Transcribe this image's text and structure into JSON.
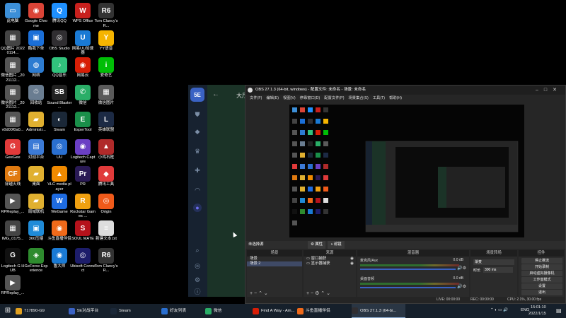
{
  "desktop": {
    "icons": [
      {
        "label": "此电脑",
        "color": "#3c8fd8",
        "glyph": "▭"
      },
      {
        "label": "Google Chrome",
        "color": "#db4437",
        "glyph": "◉"
      },
      {
        "label": "腾讯QQ",
        "color": "#1e90ff",
        "glyph": "Q"
      },
      {
        "label": "WPS Office",
        "color": "#c8201d",
        "glyph": "W"
      },
      {
        "label": "Tom Clancy's R...",
        "color": "#333333",
        "glyph": "R6"
      },
      {
        "label": "QQ图片 20220114...",
        "color": "#444444",
        "glyph": "▦"
      },
      {
        "label": "酷我下单",
        "color": "#1b6fd8",
        "glyph": "▣"
      },
      {
        "label": "OBS Studio",
        "color": "#302e31",
        "glyph": "◎"
      },
      {
        "label": "网易UU加速器",
        "color": "#1a7ad4",
        "glyph": "U"
      },
      {
        "label": "YY语音",
        "color": "#f5b400",
        "glyph": "Y"
      },
      {
        "label": "微信图片 _2021112...",
        "color": "#555555",
        "glyph": "▦"
      },
      {
        "label": "网络",
        "color": "#2d7cd1",
        "glyph": "◍"
      },
      {
        "label": "QQ音乐",
        "color": "#31c27c",
        "glyph": "♪"
      },
      {
        "label": "网易云",
        "color": "#d81e06",
        "glyph": "◉"
      },
      {
        "label": "爱奇艺",
        "color": "#00be06",
        "glyph": "i"
      },
      {
        "label": "微信图片 _2021112...",
        "color": "#555555",
        "glyph": "▦"
      },
      {
        "label": "回收站",
        "color": "#6a7d91",
        "glyph": "♲"
      },
      {
        "label": "Sound Blaster ...",
        "color": "#222222",
        "glyph": "SB"
      },
      {
        "label": "微信",
        "color": "#2aae67",
        "glyph": "✆"
      },
      {
        "label": "微信图片",
        "color": "#5a5a5a",
        "glyph": "▦"
      },
      {
        "label": "v0d00f0a0...",
        "color": "#555555",
        "glyph": "▦"
      },
      {
        "label": "Administr...",
        "color": "#e0b030",
        "glyph": "▰"
      },
      {
        "label": "Steam",
        "color": "#1b2838",
        "glyph": "◐"
      },
      {
        "label": "EsperTool",
        "color": "#1a8f4a",
        "glyph": "E"
      },
      {
        "label": "英雄联盟",
        "color": "#1c2a44",
        "glyph": "L"
      },
      {
        "label": "GeeGee",
        "color": "#e23a3a",
        "glyph": "G"
      },
      {
        "label": "对战平台",
        "color": "#3c7ad6",
        "glyph": "▤"
      },
      {
        "label": "UU",
        "color": "#2a6fd0",
        "glyph": "◎"
      },
      {
        "label": "Logitech Capture",
        "color": "#6b3fc4",
        "glyph": "◉"
      },
      {
        "label": "小鸡右框",
        "color": "#b02a2a",
        "glyph": "▲"
      },
      {
        "label": "穿越火线",
        "color": "#e07a10",
        "glyph": "CF"
      },
      {
        "label": "桌面",
        "color": "#e0b030",
        "glyph": "▰"
      },
      {
        "label": "VLC media player",
        "color": "#f08a00",
        "glyph": "▲"
      },
      {
        "label": "PR",
        "color": "#2a1a55",
        "glyph": "Pr"
      },
      {
        "label": "腾讯工具",
        "color": "#e03a3a",
        "glyph": "◆"
      },
      {
        "label": "RPReplay_...",
        "color": "#555555",
        "glyph": "▶"
      },
      {
        "label": "局域联机",
        "color": "#e0b030",
        "glyph": "▰"
      },
      {
        "label": "WeGame",
        "color": "#1e6be0",
        "glyph": "W"
      },
      {
        "label": "Rockstar Games ...",
        "color": "#f0a010",
        "glyph": "R"
      },
      {
        "label": "Origin",
        "color": "#f05a1a",
        "glyph": "◎"
      },
      {
        "label": "IMG_0175...",
        "color": "#444444",
        "glyph": "▦"
      },
      {
        "label": "360压缩",
        "color": "#1f8bd8",
        "glyph": "▣"
      },
      {
        "label": "斗鱼直播伴侣",
        "color": "#f06a1a",
        "glyph": "◉"
      },
      {
        "label": "SOUL MATE",
        "color": "#b5121b",
        "glyph": "S"
      },
      {
        "label": "新建文本.txt",
        "color": "#dddddd",
        "glyph": "≡"
      },
      {
        "label": "Logitech G HUB",
        "color": "#111111",
        "glyph": "G"
      },
      {
        "label": "GeForce Experience",
        "color": "#2e8b2e",
        "glyph": "◈"
      },
      {
        "label": "鲁大师",
        "color": "#1a7ad4",
        "glyph": "◉"
      },
      {
        "label": "Ubisoft Connect",
        "color": "#1d1d6a",
        "glyph": "◎"
      },
      {
        "label": "Tom Clancy's R...",
        "color": "#333333",
        "glyph": "R6"
      },
      {
        "label": "RPReplay_...",
        "color": "#555555",
        "glyph": "▶"
      }
    ]
  },
  "launcher": {
    "logo": "5E",
    "back": "←",
    "hall": "大厅"
  },
  "obs": {
    "title": "OBS 27.1.3 (64-bit, windows) - 配置文件: 未命名 - 场景: 未命名",
    "menu": [
      "文件(F)",
      "编辑(E)",
      "视图(V)",
      "停靠窗口(D)",
      "配置文件(P)",
      "场景集合(S)",
      "工具(T)",
      "帮助(H)"
    ],
    "source_bar": {
      "label": "未选择源",
      "props": "属性",
      "filters": "滤镜"
    },
    "scenes": {
      "title": "场景",
      "items": [
        "场景",
        "场景 2"
      ]
    },
    "sources": {
      "title": "来源",
      "items": [
        "窗口捕获",
        "显示器捕获"
      ]
    },
    "mixer": {
      "title": "混音器",
      "rows": [
        {
          "name": "麦克风/Aux",
          "db": "0.0 dB"
        },
        {
          "name": "桌面音频",
          "db": "0.0 dB"
        }
      ]
    },
    "transitions": {
      "title": "场景转场",
      "type": "渐变",
      "duration_label": "时长",
      "duration": "300 ms"
    },
    "controls": {
      "title": "控件",
      "buttons": [
        "停止推流",
        "开始录制",
        "启动虚拟摄像机",
        "工作室模式",
        "设置",
        "退出"
      ]
    },
    "status": {
      "live": "LIVE: 00:00:00",
      "rec": "REC: 00:00:00",
      "cpu": "CPU: 2.1%, 30.00 fps"
    }
  },
  "taskbar": {
    "buttons": [
      {
        "label": "717890-G9",
        "color": "#e0a020"
      },
      {
        "label": "5E对战平台",
        "color": "#3a62c4"
      },
      {
        "label": "Steam",
        "color": "#1b2838"
      },
      {
        "label": "好友列表",
        "color": "#2a6fd0"
      },
      {
        "label": "微信",
        "color": "#2aae67"
      },
      {
        "label": "Find A Way - Am...",
        "color": "#d81e06"
      },
      {
        "label": "斗鱼直播伴侣",
        "color": "#f06a1a"
      },
      {
        "label": "OBS 27.1.3 (64-bi...",
        "color": "#302e31"
      }
    ],
    "lang": "ENG",
    "time": "15:01:10",
    "date": "2022/1/15"
  }
}
